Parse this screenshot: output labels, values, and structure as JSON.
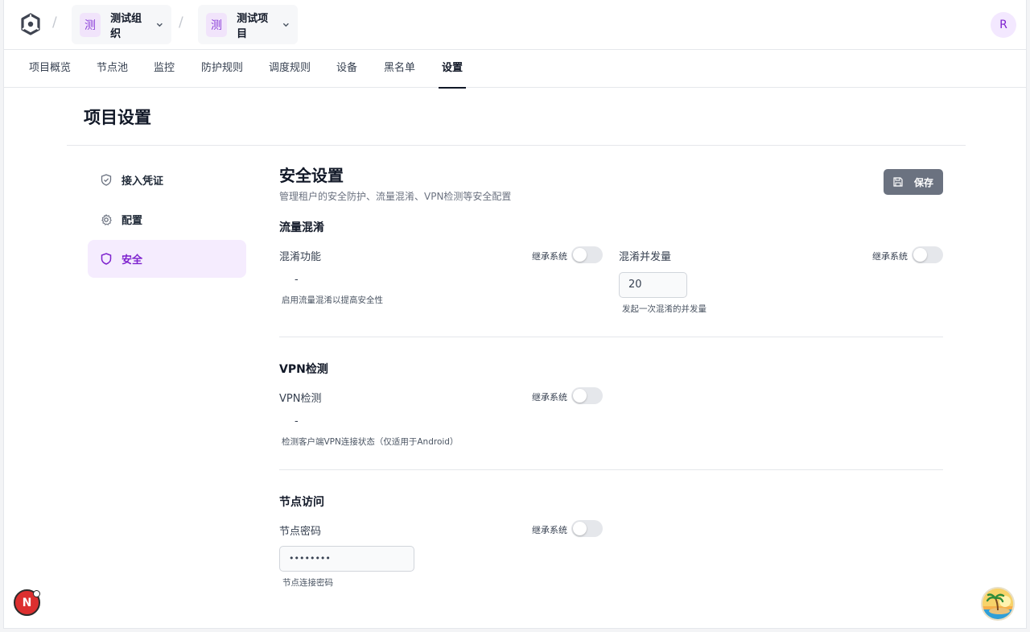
{
  "header": {
    "org": {
      "avatar_char": "测",
      "name": "测试组织"
    },
    "project": {
      "avatar_char": "测",
      "name": "测试项目"
    },
    "separator": "/",
    "user_initial": "R"
  },
  "tabs": [
    {
      "label": "项目概览"
    },
    {
      "label": "节点池"
    },
    {
      "label": "监控"
    },
    {
      "label": "防护规则"
    },
    {
      "label": "调度规则"
    },
    {
      "label": "设备"
    },
    {
      "label": "黑名单"
    },
    {
      "label": "设置",
      "active": true
    }
  ],
  "page": {
    "title": "项目设置"
  },
  "sidebar": {
    "items": [
      {
        "label": "接入凭证",
        "icon": "shield-check-icon"
      },
      {
        "label": "配置",
        "icon": "gear-icon"
      },
      {
        "label": "安全",
        "icon": "shield-icon",
        "active": true
      }
    ]
  },
  "section": {
    "title": "安全设置",
    "description": "管理租户的安全防护、流量混淆、VPN检测等安全配置",
    "save_label": "保存"
  },
  "groups": {
    "obfuscation": {
      "title": "流量混淆",
      "feature": {
        "label": "混淆功能",
        "inherit_label": "继承系统",
        "inherit_on": false,
        "value": "-",
        "help": "启用流量混淆以提高安全性"
      },
      "concurrency": {
        "label": "混淆并发量",
        "inherit_label": "继承系统",
        "inherit_on": false,
        "value": "20",
        "help": "发起一次混淆的并发量"
      }
    },
    "vpn": {
      "title": "VPN检测",
      "feature": {
        "label": "VPN检测",
        "inherit_label": "继承系统",
        "inherit_on": false,
        "value": "-",
        "help": "检测客户端VPN连接状态（仅适用于Android）"
      }
    },
    "node_access": {
      "title": "节点访问",
      "password": {
        "label": "节点密码",
        "inherit_label": "继承系统",
        "inherit_on": false,
        "value": "••••••••",
        "help": "节点连接密码"
      }
    }
  },
  "floating": {
    "badge_letter": "N"
  },
  "colors": {
    "accent": "#7e22ce",
    "accent_bg": "#f5ecfe",
    "save_button": "#6b7280"
  }
}
